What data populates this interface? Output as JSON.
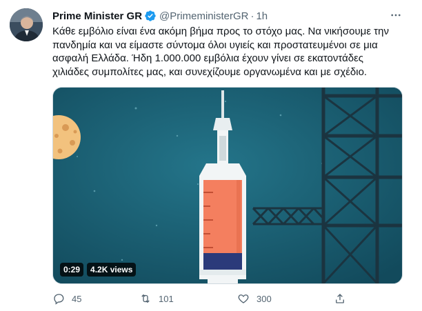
{
  "author": {
    "name": "Prime Minister GR",
    "handle": "@PrimeministerGR",
    "separator": "·",
    "time": "1h",
    "verified": true
  },
  "tweet_text": [
    "Κάθε εμβόλιο είναι ένα ακόμη βήμα προς το στόχο μας. Να νικήσουμε την",
    "πανδημία και να είμαστε σύντομα όλοι υγιείς και προστατευμένοι σε μια",
    "ασφαλή Ελλάδα. Ήδη 1.000.000 εμβόλια έχουν γίνει σε εκατοντάδες",
    "χιλιάδες συμπολίτες μας, και συνεχίζουμε οργανωμένα και με σχέδιο."
  ],
  "video": {
    "duration": "0:29",
    "views": "4.2K views"
  },
  "actions": {
    "replies": "45",
    "retweets": "101",
    "likes": "300"
  },
  "icons": [
    "verified-badge-icon",
    "more-options-icon",
    "reply-icon",
    "retweet-icon",
    "like-icon",
    "share-icon"
  ],
  "colors": {
    "verified": "#1d9bf0",
    "secondary_text": "#536471",
    "video_bg": "#1a5f74",
    "syringe_liquid": "#f47f5f"
  }
}
